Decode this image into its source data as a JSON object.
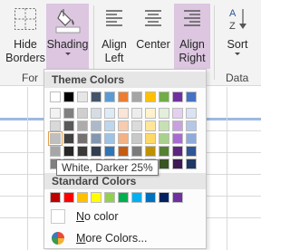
{
  "ribbon": {
    "hide_borders": {
      "line1": "Hide",
      "line2": "Borders"
    },
    "shading": {
      "label": "Shading"
    },
    "align_left": {
      "line1": "Align",
      "line2": "Left"
    },
    "center": {
      "label": "Center"
    },
    "align_right": {
      "line1": "Align",
      "line2": "Right"
    },
    "sort": {
      "label": "Sort"
    },
    "group_format": "For",
    "group_data": "Data",
    "sort_icon_text": "A Z"
  },
  "shading_menu": {
    "theme_colors_header": "Theme Colors",
    "standard_colors_header": "Standard Colors",
    "no_color_label": "No color",
    "no_color_mnemonic": "N",
    "more_colors_label": "More Colors...",
    "more_colors_mnemonic": "M",
    "tooltip": "White, Darker 25%",
    "theme_top_row": [
      "#ffffff",
      "#000000",
      "#e7e6e6",
      "#44546a",
      "#5b9bd5",
      "#ed7d31",
      "#a5a5a5",
      "#ffc000",
      "#70ad47",
      "#7030a0",
      "#4472c4"
    ],
    "theme_columns": [
      [
        "#f2f2f2",
        "#d9d9d9",
        "#bfbfbf",
        "#a6a6a6",
        "#808080"
      ],
      [
        "#7f7f7f",
        "#595959",
        "#404040",
        "#262626",
        "#0d0d0d"
      ],
      [
        "#d0cece",
        "#afabab",
        "#767171",
        "#3b3838",
        "#171717"
      ],
      [
        "#d6dce4",
        "#adb9ca",
        "#8497b0",
        "#333f4f",
        "#222a35"
      ],
      [
        "#ddebf7",
        "#bdd7ee",
        "#9dc3e6",
        "#2e75b6",
        "#1f4e79"
      ],
      [
        "#fbe5d6",
        "#f8cbad",
        "#f4b183",
        "#c55a11",
        "#833c0b"
      ],
      [
        "#ededed",
        "#dbdbdb",
        "#c9c9c9",
        "#7b7b7b",
        "#525252"
      ],
      [
        "#fff2cc",
        "#ffe699",
        "#ffd966",
        "#bf9000",
        "#7f6000"
      ],
      [
        "#e2efda",
        "#c6e0b4",
        "#a9d18e",
        "#548235",
        "#375623"
      ],
      [
        "#e4d0f0",
        "#c9a1e0",
        "#a86bcf",
        "#5b2580",
        "#3c1855"
      ],
      [
        "#dae3f3",
        "#b4c7e7",
        "#8faadc",
        "#2f5597",
        "#203864"
      ]
    ],
    "standard_colors": [
      "#c00000",
      "#ff0000",
      "#ffc000",
      "#ffff00",
      "#92d050",
      "#00b050",
      "#00b0f0",
      "#0070c0",
      "#002060",
      "#7030a0"
    ]
  }
}
